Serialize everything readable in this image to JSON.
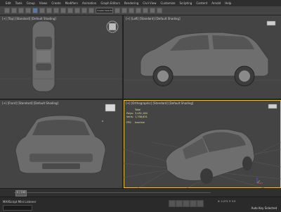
{
  "menu": {
    "items": [
      "Edit",
      "Tools",
      "Group",
      "Views",
      "Create",
      "Modifiers",
      "Animation",
      "Graph Editors",
      "Rendering",
      "Civil View",
      "Customize",
      "Scripting",
      "Content",
      "Arnold",
      "Help"
    ]
  },
  "toolbar": {
    "selection_set": "Create Selection Se"
  },
  "viewports": {
    "top": {
      "label": "[+] [Top] [Standard] [Default Shading]"
    },
    "left": {
      "label": "[+] [Left] [Standard] [Default Shading]"
    },
    "front": {
      "label": "[+] [Front] [Standard] [Default Shading]"
    },
    "persp": {
      "label": "[+] [Orthographic] [Standard] [Default Shading]",
      "stats": {
        "header": "Total",
        "polys_label": "Polys:",
        "polys_value": "3,451,184",
        "verts_label": "Verts:",
        "verts_value": "1,706,631",
        "fps_label": "FPS:",
        "fps_value": "Inactive"
      }
    }
  },
  "timeline": {
    "frame": "0 / 100"
  },
  "status": {
    "prompt": "MAXScript Mini Listener",
    "coords": "X: 1.271 Y: 3.5",
    "snap": "Auto Key Selected"
  },
  "colors": {
    "active_border": "#e8c23a",
    "viewport_bg": "#444444",
    "stats_text": "#e6e6a0"
  }
}
